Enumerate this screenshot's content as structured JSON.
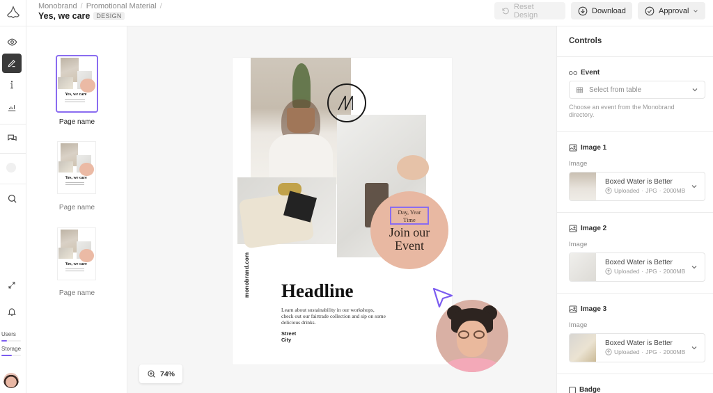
{
  "header": {
    "breadcrumb": [
      "Monobrand",
      "Promotional Material"
    ],
    "title": "Yes, we care",
    "badge": "DESIGN",
    "buttons": {
      "reset": "Reset Design",
      "download": "Download",
      "approval": "Approval"
    }
  },
  "rail": {
    "icons": [
      "eye-icon",
      "pen-icon",
      "info-icon",
      "chart-icon",
      "comments-icon",
      "status-dot",
      "search-icon",
      "expand-icon",
      "bell-icon"
    ],
    "active": "pen-icon",
    "meters": [
      {
        "label": "Users",
        "value": 0.3
      },
      {
        "label": "Storage",
        "value": 0.55
      }
    ]
  },
  "pages": {
    "items": [
      {
        "name": "Page name",
        "thumb_title": "Yes, we care",
        "selected": true
      },
      {
        "name": "Page name",
        "thumb_title": "Yes, we care",
        "selected": false
      },
      {
        "name": "Page name",
        "thumb_title": "Yes, we care",
        "selected": false
      }
    ]
  },
  "canvas": {
    "poster": {
      "vertical_text": "monobrand.com",
      "date_line1": "Day, Year",
      "date_line2": "Time",
      "circle_line1": "Join our",
      "circle_line2": "Event",
      "headline": "Headline",
      "body": "Learn about sustainability in our workshops, check out our fairtrade collection and sip on some delicious drinks.",
      "street": "Street",
      "city": "City"
    },
    "zoom": "74%",
    "accent": "#8a6cf0"
  },
  "controls": {
    "title": "Controls",
    "event": {
      "label": "Event",
      "placeholder": "Select from table",
      "help": "Choose an event from the Monobrand directory."
    },
    "images": [
      {
        "label": "Image 1",
        "sublabel": "Image",
        "name": "Boxed Water is Better",
        "status": "Uploaded",
        "type": "JPG",
        "size": "2000MB"
      },
      {
        "label": "Image 2",
        "sublabel": "Image",
        "name": "Boxed Water is Better",
        "status": "Uploaded",
        "type": "JPG",
        "size": "2000MB"
      },
      {
        "label": "Image 3",
        "sublabel": "Image",
        "name": "Boxed Water is Better",
        "status": "Uploaded",
        "type": "JPG",
        "size": "2000MB"
      }
    ],
    "badge_label": "Badge"
  }
}
